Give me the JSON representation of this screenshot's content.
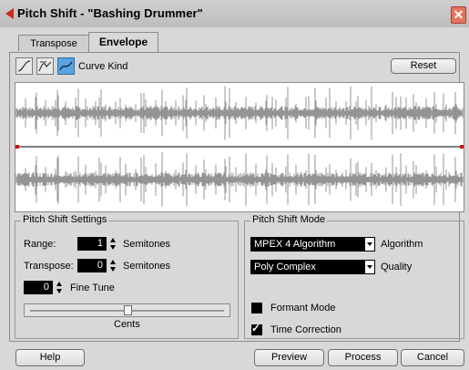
{
  "window": {
    "title": "Pitch Shift - \"Bashing Drummer\""
  },
  "tabs": [
    {
      "label": "Transpose",
      "active": false
    },
    {
      "label": "Envelope",
      "active": true
    }
  ],
  "curve": {
    "label": "Curve Kind",
    "buttons": [
      "curve-kind-smooth",
      "curve-kind-bezier",
      "curve-kind-spline"
    ],
    "selected_index": 2,
    "reset_label": "Reset"
  },
  "settings": {
    "group_label": "Pitch Shift Settings",
    "range_label": "Range:",
    "range_value": "1",
    "range_unit": "Semitones",
    "transpose_label": "Transpose:",
    "transpose_value": "0",
    "transpose_unit": "Semitones",
    "finetune_value": "0",
    "finetune_label": "Fine Tune",
    "cents_label": "Cents",
    "slider_level": 0.5
  },
  "mode": {
    "group_label": "Pitch Shift Mode",
    "algorithm_value": "MPEX 4 Algorithm",
    "algorithm_label": "Algorithm",
    "quality_value": "Poly Complex",
    "quality_label": "Quality",
    "formant_label": "Formant Mode",
    "formant_checked": false,
    "timecorr_label": "Time Correction",
    "timecorr_checked": true
  },
  "footer": {
    "help": "Help",
    "preview": "Preview",
    "process": "Process",
    "cancel": "Cancel"
  },
  "colors": {
    "accent": "#5aa3e0",
    "close": "#e4745d",
    "envelope_line": "#000000",
    "envelope_point": "#d01010",
    "waveform": "#7a7a7a"
  }
}
